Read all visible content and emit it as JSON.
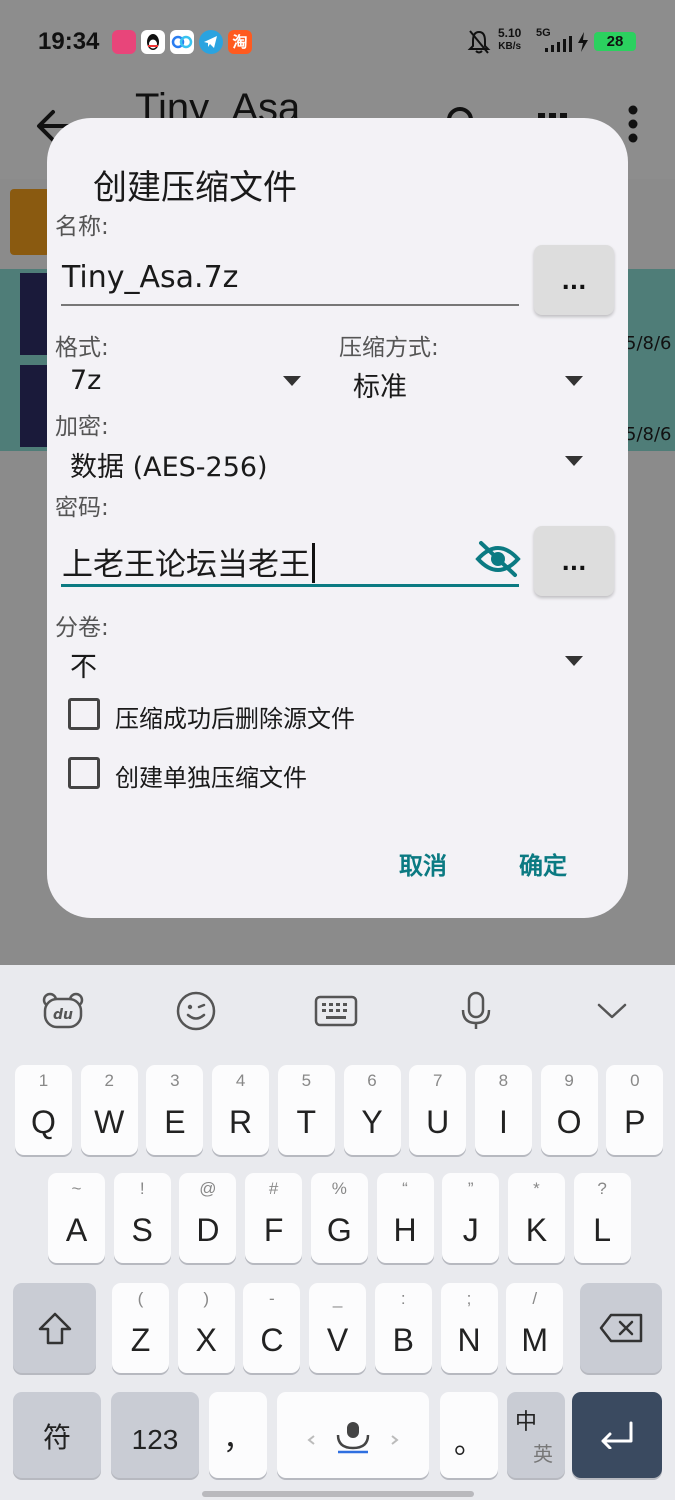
{
  "status_bar": {
    "time": "19:34",
    "net_speed": "5.10",
    "net_unit": "KB/s",
    "network": "5G",
    "battery": "28",
    "app_icons": [
      "app-icon-pink",
      "qq-icon",
      "baidu-netdisk-icon",
      "telegram-icon",
      "taobao-icon"
    ],
    "taobao_glyph": "淘"
  },
  "background_app": {
    "title": "Tiny_Asa",
    "row_dates": [
      "5/8/6",
      "5/8/6"
    ]
  },
  "dialog": {
    "title": "创建压缩文件",
    "name_label": "名称:",
    "name_value": "Tiny_Asa.7z",
    "browse_label": "...",
    "format_label": "格式:",
    "format_value": "7z",
    "method_label": "压缩方式:",
    "method_value": "标准",
    "encryption_label": "加密:",
    "encryption_value": "数据 (AES-256)",
    "password_label": "密码:",
    "password_value": "上老王论坛当老王",
    "password_gen_label": "...",
    "split_label": "分卷:",
    "split_value": "不",
    "option_delete": "压缩成功后删除源文件",
    "option_separate": "创建单独压缩文件",
    "option_delete_checked": false,
    "option_separate_checked": false,
    "cancel": "取消",
    "ok": "确定",
    "accent_color": "#0b7a82"
  },
  "keyboard": {
    "toolbar": [
      "du-bear-icon",
      "emoji-icon",
      "keyboard-icon",
      "microphone-icon",
      "collapse-chevron-icon"
    ],
    "du_label": "du",
    "row1": [
      {
        "hint": "1",
        "key": "Q"
      },
      {
        "hint": "2",
        "key": "W"
      },
      {
        "hint": "3",
        "key": "E"
      },
      {
        "hint": "4",
        "key": "R"
      },
      {
        "hint": "5",
        "key": "T"
      },
      {
        "hint": "6",
        "key": "Y"
      },
      {
        "hint": "7",
        "key": "U"
      },
      {
        "hint": "8",
        "key": "I"
      },
      {
        "hint": "9",
        "key": "O"
      },
      {
        "hint": "0",
        "key": "P"
      }
    ],
    "row2": [
      {
        "hint": "~",
        "key": "A"
      },
      {
        "hint": "!",
        "key": "S"
      },
      {
        "hint": "@",
        "key": "D"
      },
      {
        "hint": "#",
        "key": "F"
      },
      {
        "hint": "%",
        "key": "G"
      },
      {
        "hint": "“",
        "key": "H"
      },
      {
        "hint": "”",
        "key": "J"
      },
      {
        "hint": "*",
        "key": "K"
      },
      {
        "hint": "?",
        "key": "L"
      }
    ],
    "row3": [
      {
        "hint": "(",
        "key": "Z"
      },
      {
        "hint": ")",
        "key": "X"
      },
      {
        "hint": "-",
        "key": "C"
      },
      {
        "hint": "_",
        "key": "V"
      },
      {
        "hint": ":",
        "key": "B"
      },
      {
        "hint": ";",
        "key": "N"
      },
      {
        "hint": "/",
        "key": "M"
      }
    ],
    "symbols": "符",
    "numbers": "123",
    "comma": "，",
    "period": "。",
    "lang_top": "中",
    "lang_bottom": "英"
  }
}
